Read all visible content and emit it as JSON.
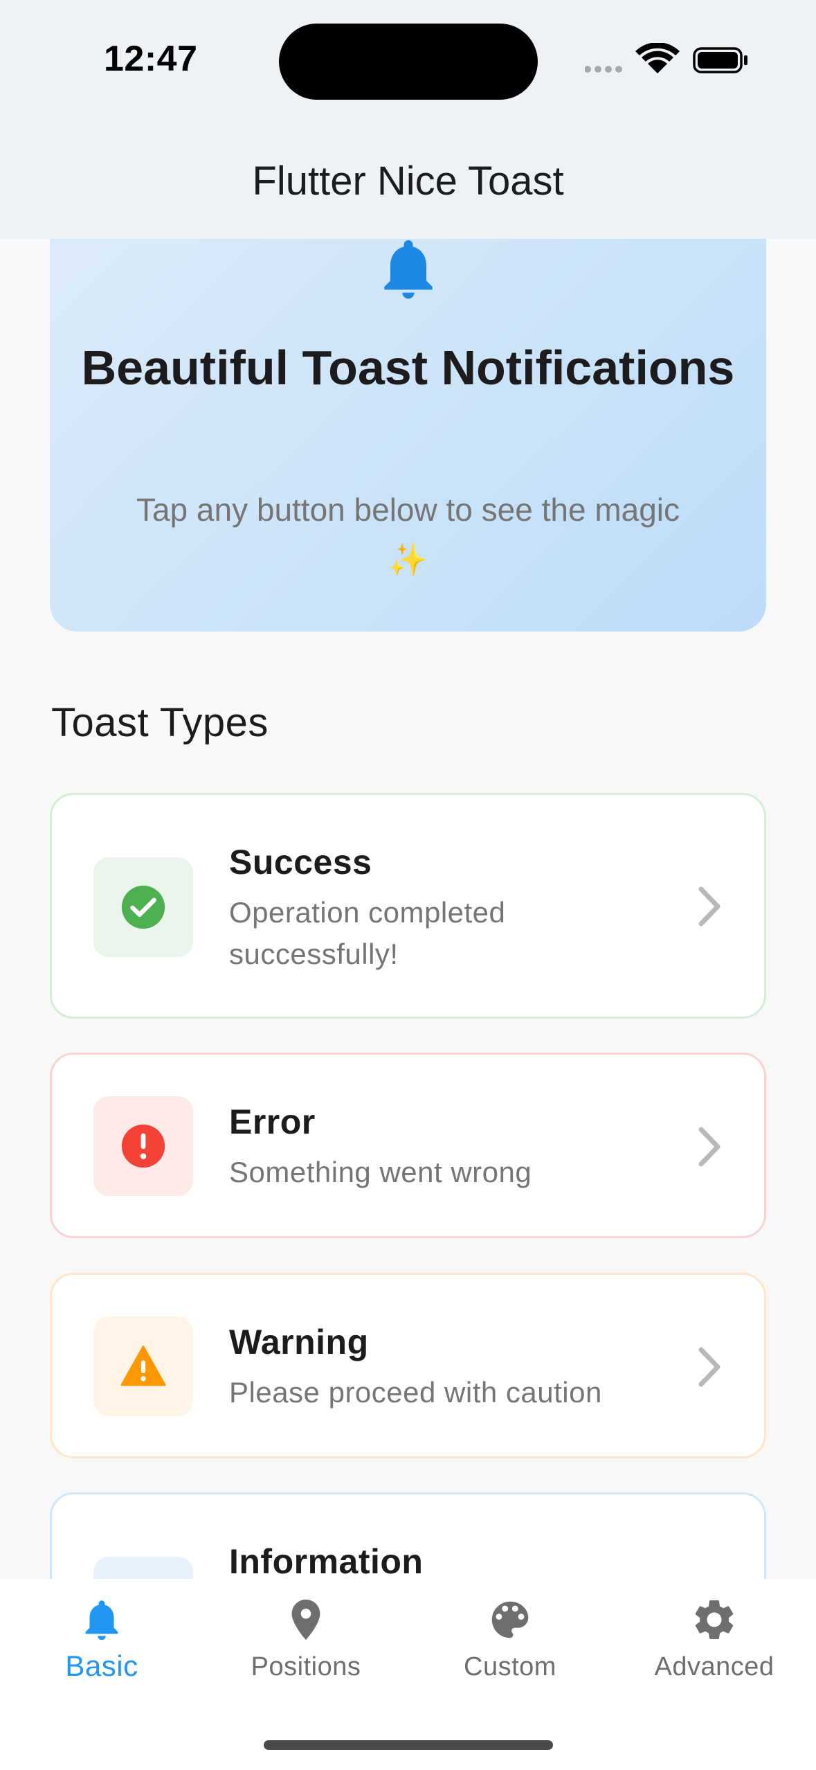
{
  "status_bar": {
    "time": "12:47"
  },
  "app_bar": {
    "title": "Flutter Nice Toast"
  },
  "hero": {
    "icon": "bell-icon",
    "title": "Beautiful Toast Notifications",
    "subtitle": "Tap any button below to see the magic ✨"
  },
  "section": {
    "title": "Toast Types"
  },
  "toast_types": [
    {
      "title": "Success",
      "description": "Operation completed successfully!",
      "icon": "check-circle-icon",
      "accent": "#4CAF50",
      "bg": "#EBF5EC",
      "border": "#D5EDD6"
    },
    {
      "title": "Error",
      "description": "Something went wrong",
      "icon": "error-circle-icon",
      "accent": "#F44336",
      "bg": "#FDE9E8",
      "border": "#F9D3D0"
    },
    {
      "title": "Warning",
      "description": "Please proceed with caution",
      "icon": "warning-triangle-icon",
      "accent": "#FF9800",
      "bg": "#FFF4E5",
      "border": "#FDE6CB"
    },
    {
      "title": "Information",
      "description": "",
      "icon": "info-icon",
      "accent": "#2196F3",
      "bg": "#E8F2FD",
      "border": "#D2E6FB"
    }
  ],
  "bottom_nav": {
    "items": [
      {
        "label": "Basic",
        "icon": "bell-icon",
        "active": true
      },
      {
        "label": "Positions",
        "icon": "location-pin-icon",
        "active": false
      },
      {
        "label": "Custom",
        "icon": "palette-icon",
        "active": false
      },
      {
        "label": "Advanced",
        "icon": "gear-icon",
        "active": false
      }
    ],
    "active_color": "#2196F3",
    "inactive_color": "#6E6E6E"
  }
}
